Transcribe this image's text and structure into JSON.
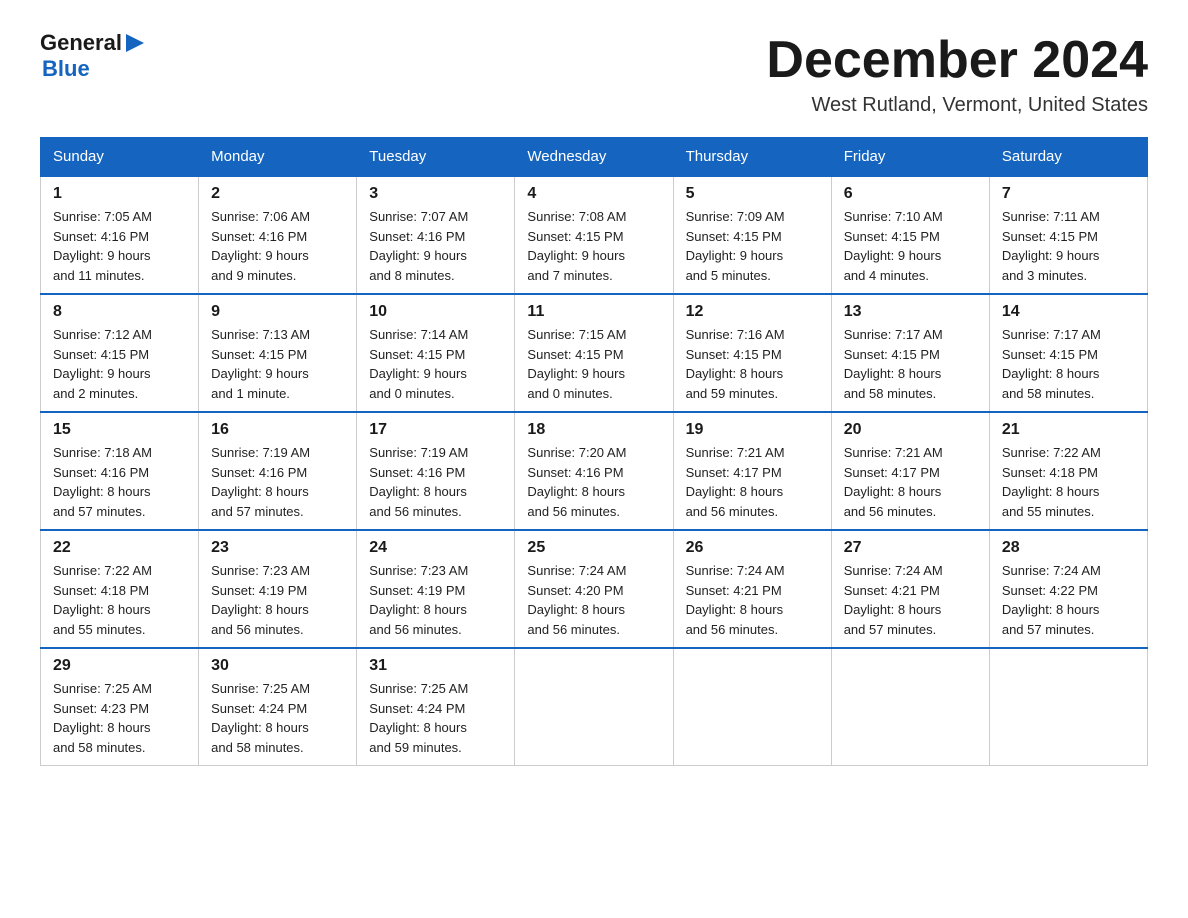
{
  "logo": {
    "general": "General",
    "blue": "Blue"
  },
  "title": {
    "month_year": "December 2024",
    "location": "West Rutland, Vermont, United States"
  },
  "headers": [
    "Sunday",
    "Monday",
    "Tuesday",
    "Wednesday",
    "Thursday",
    "Friday",
    "Saturday"
  ],
  "weeks": [
    [
      {
        "day": "1",
        "sunrise": "Sunrise: 7:05 AM",
        "sunset": "Sunset: 4:16 PM",
        "daylight": "Daylight: 9 hours",
        "daylight2": "and 11 minutes."
      },
      {
        "day": "2",
        "sunrise": "Sunrise: 7:06 AM",
        "sunset": "Sunset: 4:16 PM",
        "daylight": "Daylight: 9 hours",
        "daylight2": "and 9 minutes."
      },
      {
        "day": "3",
        "sunrise": "Sunrise: 7:07 AM",
        "sunset": "Sunset: 4:16 PM",
        "daylight": "Daylight: 9 hours",
        "daylight2": "and 8 minutes."
      },
      {
        "day": "4",
        "sunrise": "Sunrise: 7:08 AM",
        "sunset": "Sunset: 4:15 PM",
        "daylight": "Daylight: 9 hours",
        "daylight2": "and 7 minutes."
      },
      {
        "day": "5",
        "sunrise": "Sunrise: 7:09 AM",
        "sunset": "Sunset: 4:15 PM",
        "daylight": "Daylight: 9 hours",
        "daylight2": "and 5 minutes."
      },
      {
        "day": "6",
        "sunrise": "Sunrise: 7:10 AM",
        "sunset": "Sunset: 4:15 PM",
        "daylight": "Daylight: 9 hours",
        "daylight2": "and 4 minutes."
      },
      {
        "day": "7",
        "sunrise": "Sunrise: 7:11 AM",
        "sunset": "Sunset: 4:15 PM",
        "daylight": "Daylight: 9 hours",
        "daylight2": "and 3 minutes."
      }
    ],
    [
      {
        "day": "8",
        "sunrise": "Sunrise: 7:12 AM",
        "sunset": "Sunset: 4:15 PM",
        "daylight": "Daylight: 9 hours",
        "daylight2": "and 2 minutes."
      },
      {
        "day": "9",
        "sunrise": "Sunrise: 7:13 AM",
        "sunset": "Sunset: 4:15 PM",
        "daylight": "Daylight: 9 hours",
        "daylight2": "and 1 minute."
      },
      {
        "day": "10",
        "sunrise": "Sunrise: 7:14 AM",
        "sunset": "Sunset: 4:15 PM",
        "daylight": "Daylight: 9 hours",
        "daylight2": "and 0 minutes."
      },
      {
        "day": "11",
        "sunrise": "Sunrise: 7:15 AM",
        "sunset": "Sunset: 4:15 PM",
        "daylight": "Daylight: 9 hours",
        "daylight2": "and 0 minutes."
      },
      {
        "day": "12",
        "sunrise": "Sunrise: 7:16 AM",
        "sunset": "Sunset: 4:15 PM",
        "daylight": "Daylight: 8 hours",
        "daylight2": "and 59 minutes."
      },
      {
        "day": "13",
        "sunrise": "Sunrise: 7:17 AM",
        "sunset": "Sunset: 4:15 PM",
        "daylight": "Daylight: 8 hours",
        "daylight2": "and 58 minutes."
      },
      {
        "day": "14",
        "sunrise": "Sunrise: 7:17 AM",
        "sunset": "Sunset: 4:15 PM",
        "daylight": "Daylight: 8 hours",
        "daylight2": "and 58 minutes."
      }
    ],
    [
      {
        "day": "15",
        "sunrise": "Sunrise: 7:18 AM",
        "sunset": "Sunset: 4:16 PM",
        "daylight": "Daylight: 8 hours",
        "daylight2": "and 57 minutes."
      },
      {
        "day": "16",
        "sunrise": "Sunrise: 7:19 AM",
        "sunset": "Sunset: 4:16 PM",
        "daylight": "Daylight: 8 hours",
        "daylight2": "and 57 minutes."
      },
      {
        "day": "17",
        "sunrise": "Sunrise: 7:19 AM",
        "sunset": "Sunset: 4:16 PM",
        "daylight": "Daylight: 8 hours",
        "daylight2": "and 56 minutes."
      },
      {
        "day": "18",
        "sunrise": "Sunrise: 7:20 AM",
        "sunset": "Sunset: 4:16 PM",
        "daylight": "Daylight: 8 hours",
        "daylight2": "and 56 minutes."
      },
      {
        "day": "19",
        "sunrise": "Sunrise: 7:21 AM",
        "sunset": "Sunset: 4:17 PM",
        "daylight": "Daylight: 8 hours",
        "daylight2": "and 56 minutes."
      },
      {
        "day": "20",
        "sunrise": "Sunrise: 7:21 AM",
        "sunset": "Sunset: 4:17 PM",
        "daylight": "Daylight: 8 hours",
        "daylight2": "and 56 minutes."
      },
      {
        "day": "21",
        "sunrise": "Sunrise: 7:22 AM",
        "sunset": "Sunset: 4:18 PM",
        "daylight": "Daylight: 8 hours",
        "daylight2": "and 55 minutes."
      }
    ],
    [
      {
        "day": "22",
        "sunrise": "Sunrise: 7:22 AM",
        "sunset": "Sunset: 4:18 PM",
        "daylight": "Daylight: 8 hours",
        "daylight2": "and 55 minutes."
      },
      {
        "day": "23",
        "sunrise": "Sunrise: 7:23 AM",
        "sunset": "Sunset: 4:19 PM",
        "daylight": "Daylight: 8 hours",
        "daylight2": "and 56 minutes."
      },
      {
        "day": "24",
        "sunrise": "Sunrise: 7:23 AM",
        "sunset": "Sunset: 4:19 PM",
        "daylight": "Daylight: 8 hours",
        "daylight2": "and 56 minutes."
      },
      {
        "day": "25",
        "sunrise": "Sunrise: 7:24 AM",
        "sunset": "Sunset: 4:20 PM",
        "daylight": "Daylight: 8 hours",
        "daylight2": "and 56 minutes."
      },
      {
        "day": "26",
        "sunrise": "Sunrise: 7:24 AM",
        "sunset": "Sunset: 4:21 PM",
        "daylight": "Daylight: 8 hours",
        "daylight2": "and 56 minutes."
      },
      {
        "day": "27",
        "sunrise": "Sunrise: 7:24 AM",
        "sunset": "Sunset: 4:21 PM",
        "daylight": "Daylight: 8 hours",
        "daylight2": "and 57 minutes."
      },
      {
        "day": "28",
        "sunrise": "Sunrise: 7:24 AM",
        "sunset": "Sunset: 4:22 PM",
        "daylight": "Daylight: 8 hours",
        "daylight2": "and 57 minutes."
      }
    ],
    [
      {
        "day": "29",
        "sunrise": "Sunrise: 7:25 AM",
        "sunset": "Sunset: 4:23 PM",
        "daylight": "Daylight: 8 hours",
        "daylight2": "and 58 minutes."
      },
      {
        "day": "30",
        "sunrise": "Sunrise: 7:25 AM",
        "sunset": "Sunset: 4:24 PM",
        "daylight": "Daylight: 8 hours",
        "daylight2": "and 58 minutes."
      },
      {
        "day": "31",
        "sunrise": "Sunrise: 7:25 AM",
        "sunset": "Sunset: 4:24 PM",
        "daylight": "Daylight: 8 hours",
        "daylight2": "and 59 minutes."
      },
      null,
      null,
      null,
      null
    ]
  ]
}
